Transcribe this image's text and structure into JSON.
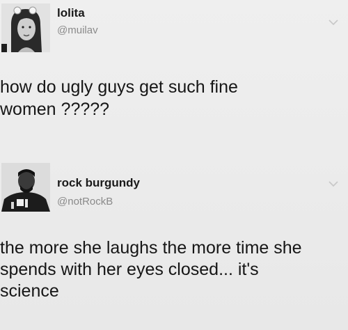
{
  "tweets": [
    {
      "display_name": "lolita",
      "handle": "@muilav",
      "text_lines": [
        "how do ugly guys get such fine",
        "women ?????"
      ],
      "avatar_icon": "profile-photo-woman",
      "menu_icon": "chevron-down-icon"
    },
    {
      "display_name": "rock burgundy",
      "handle": "@notRockB",
      "text_lines": [
        "the more she laughs the more time she",
        "spends with her eyes closed... it's",
        "science"
      ],
      "avatar_icon": "profile-photo-man",
      "menu_icon": "chevron-down-icon"
    }
  ],
  "colors": {
    "background": "#ebebeb",
    "text": "#161616",
    "handle": "#8a8a8a",
    "chevron": "#c9c9c9"
  }
}
